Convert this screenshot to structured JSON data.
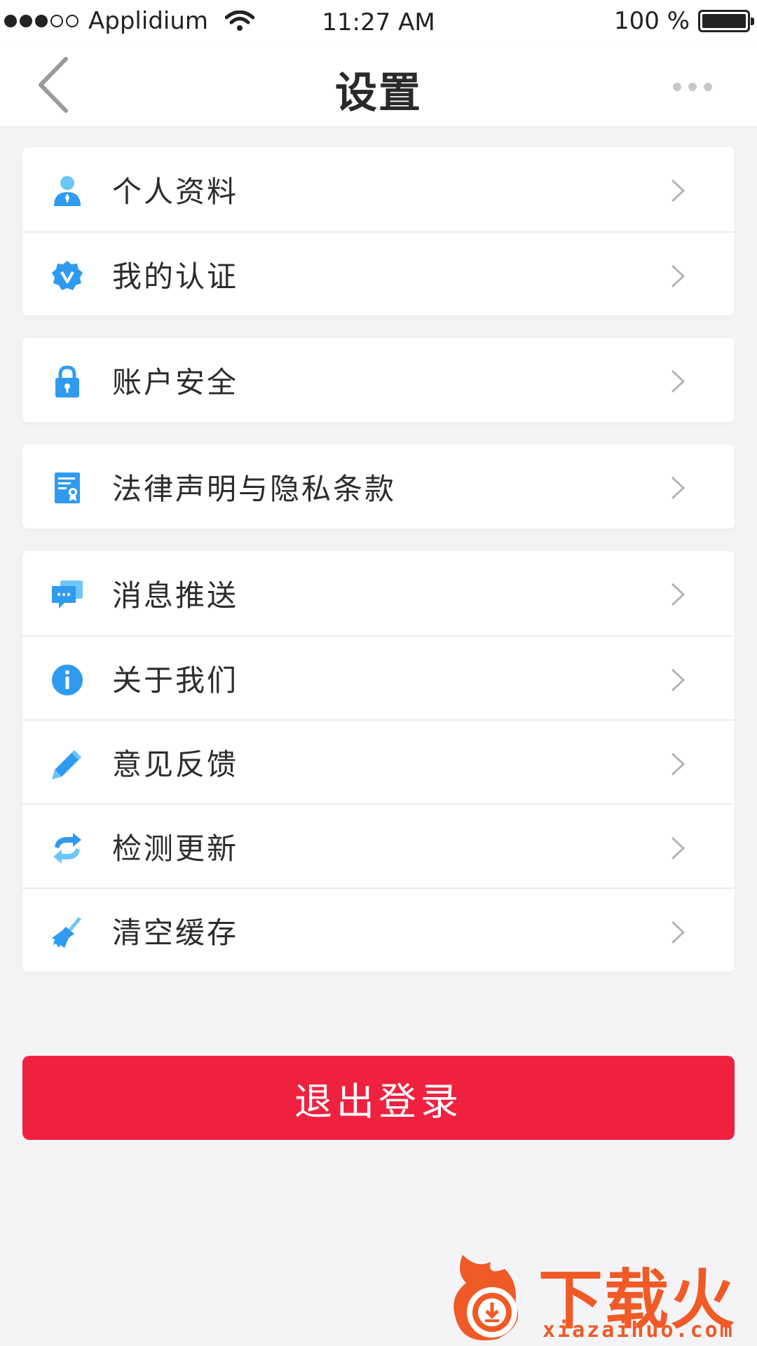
{
  "status_bar": {
    "carrier": "Applidium",
    "time": "11:27 AM",
    "battery": "100 %"
  },
  "nav": {
    "title": "设置"
  },
  "groups": [
    {
      "items": [
        {
          "label": "个人资料",
          "icon": "person-icon"
        },
        {
          "label": "我的认证",
          "icon": "verified-badge-icon"
        }
      ]
    },
    {
      "items": [
        {
          "label": "账户安全",
          "icon": "lock-icon"
        }
      ]
    },
    {
      "items": [
        {
          "label": "法律声明与隐私条款",
          "icon": "certificate-document-icon"
        }
      ]
    },
    {
      "items": [
        {
          "label": "消息推送",
          "icon": "chat-bubbles-icon"
        },
        {
          "label": "关于我们",
          "icon": "info-icon"
        },
        {
          "label": "意见反馈",
          "icon": "pencil-icon"
        },
        {
          "label": "检测更新",
          "icon": "refresh-icon"
        },
        {
          "label": "清空缓存",
          "icon": "broom-icon"
        }
      ]
    }
  ],
  "logout": {
    "label": "退出登录"
  },
  "watermark": {
    "brand": "下载火",
    "domain": "xiazaihuo.com"
  },
  "colors": {
    "accent_blue": "#2f9bf0",
    "logout_red": "#f0213f",
    "watermark_orange": "#f05a26"
  }
}
